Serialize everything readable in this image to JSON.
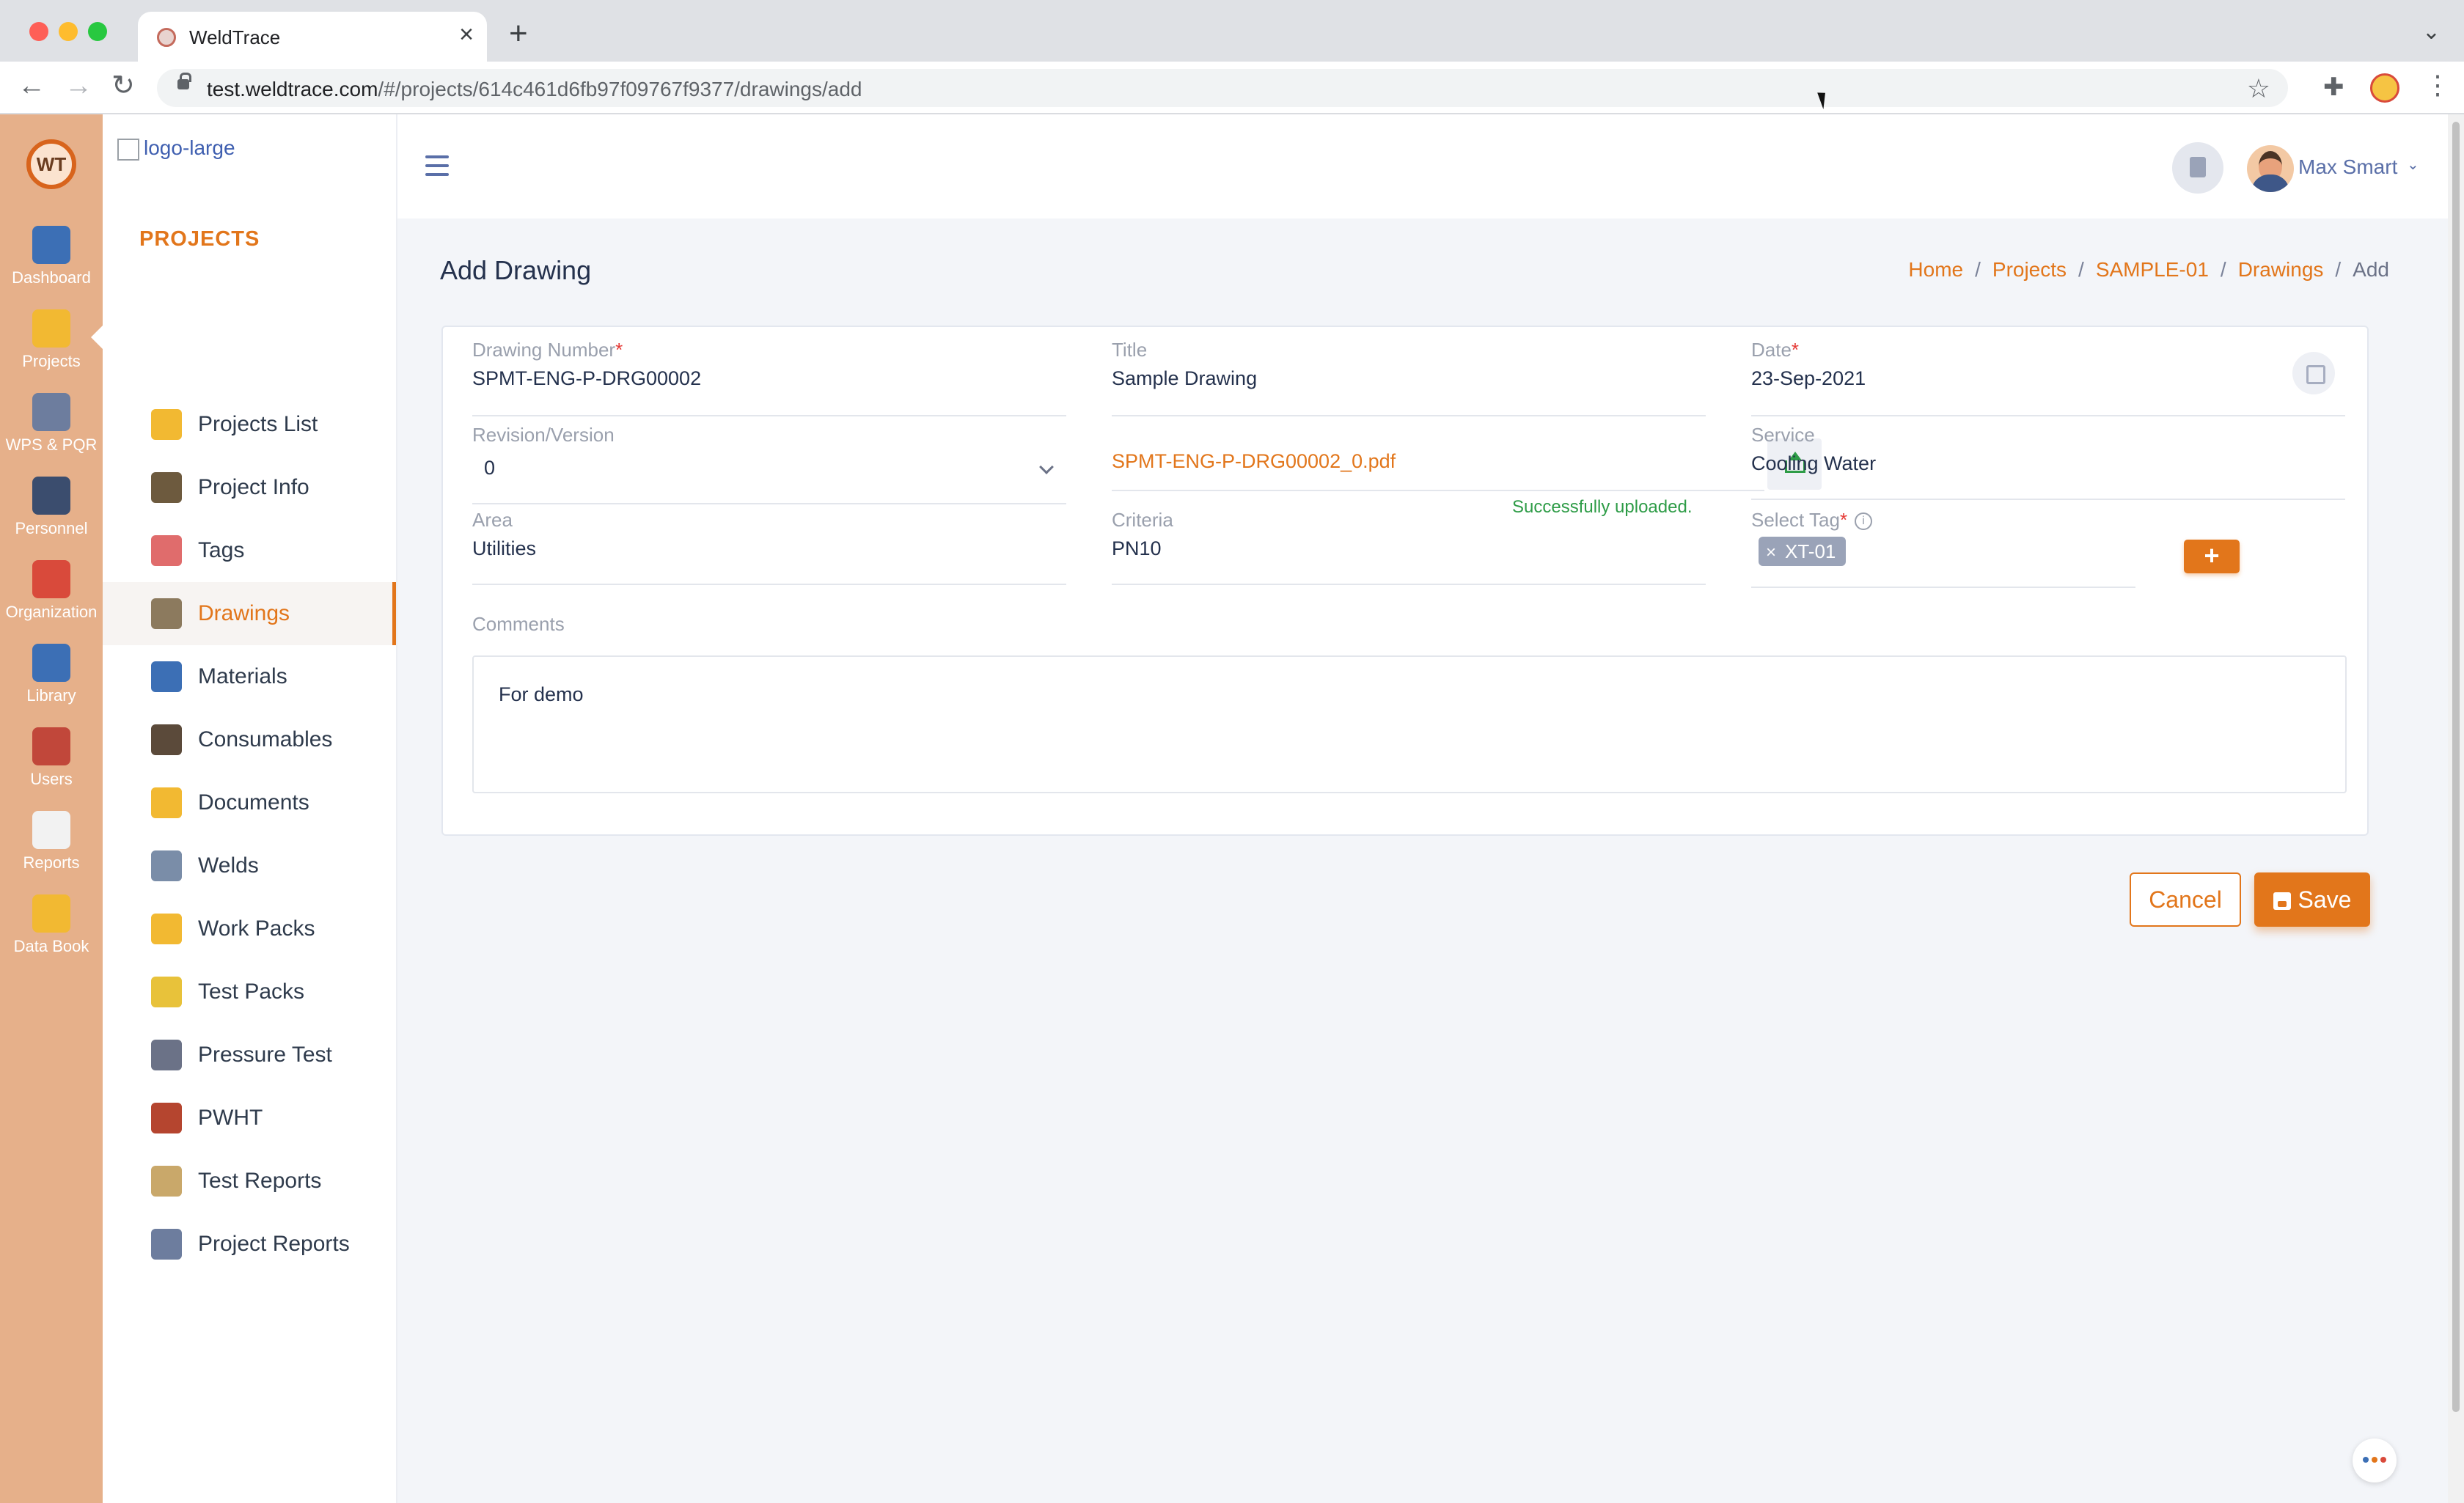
{
  "browser": {
    "tab_title": "WeldTrace",
    "url_host": "test.weldtrace.com",
    "url_path": "/#/projects/614c461d6fb97f09767f9377/drawings/add"
  },
  "rail": {
    "logo_text": "WT",
    "items": [
      {
        "label": "Dashboard",
        "icon": "dashboard-icon",
        "color": "#3c6fb5"
      },
      {
        "label": "Projects",
        "icon": "projects-folder-icon",
        "color": "#f2b932"
      },
      {
        "label": "WPS & PQR",
        "icon": "wps-pqr-icon",
        "color": "#6d7d9e"
      },
      {
        "label": "Personnel",
        "icon": "personnel-icon",
        "color": "#3b4d6e"
      },
      {
        "label": "Organization",
        "icon": "organization-icon",
        "color": "#d94a3b"
      },
      {
        "label": "Library",
        "icon": "library-icon",
        "color": "#3c6fb5"
      },
      {
        "label": "Users",
        "icon": "users-icon",
        "color": "#c1473a"
      },
      {
        "label": "Reports",
        "icon": "reports-icon",
        "color": "#f2f2f2"
      },
      {
        "label": "Data Book",
        "icon": "data-book-icon",
        "color": "#f2b932"
      }
    ]
  },
  "sidebar": {
    "logo_alt": "logo-large",
    "heading": "PROJECTS",
    "items": [
      {
        "label": "Projects List",
        "icon": "projects-list-icon",
        "color": "#f2b932"
      },
      {
        "label": "Project Info",
        "icon": "project-info-icon",
        "color": "#6d5a3e"
      },
      {
        "label": "Tags",
        "icon": "tags-icon",
        "color": "#e06c6c"
      },
      {
        "label": "Drawings",
        "icon": "drawings-icon",
        "color": "#8c7a5e"
      },
      {
        "label": "Materials",
        "icon": "materials-icon",
        "color": "#3c6fb5"
      },
      {
        "label": "Consumables",
        "icon": "consumables-icon",
        "color": "#5b4a3a"
      },
      {
        "label": "Documents",
        "icon": "documents-icon",
        "color": "#f2b932"
      },
      {
        "label": "Welds",
        "icon": "welds-icon",
        "color": "#7a8da8"
      },
      {
        "label": "Work Packs",
        "icon": "work-packs-icon",
        "color": "#f2b932"
      },
      {
        "label": "Test Packs",
        "icon": "test-packs-icon",
        "color": "#e8c23a"
      },
      {
        "label": "Pressure Test",
        "icon": "pressure-test-icon",
        "color": "#6b7287"
      },
      {
        "label": "PWHT",
        "icon": "pwht-icon",
        "color": "#b5452f"
      },
      {
        "label": "Test Reports",
        "icon": "test-reports-icon",
        "color": "#c9a86a"
      },
      {
        "label": "Project Reports",
        "icon": "project-reports-icon",
        "color": "#6d7d9e"
      }
    ]
  },
  "header": {
    "user_name": "Max Smart"
  },
  "page": {
    "title": "Add Drawing",
    "breadcrumb": [
      "Home",
      "Projects",
      "SAMPLE-01",
      "Drawings",
      "Add"
    ]
  },
  "form": {
    "drawing_number": {
      "label": "Drawing Number",
      "value": "SPMT-ENG-P-DRG00002"
    },
    "title": {
      "label": "Title",
      "value": "Sample Drawing"
    },
    "date": {
      "label": "Date",
      "value": "23-Sep-2021"
    },
    "revision": {
      "label": "Revision/Version",
      "value": "0"
    },
    "file": {
      "name": "SPMT-ENG-P-DRG00002_0.pdf",
      "status": "Successfully uploaded."
    },
    "service": {
      "label": "Service",
      "value": "Cooling Water"
    },
    "area": {
      "label": "Area",
      "value": "Utilities"
    },
    "criteria": {
      "label": "Criteria",
      "value": "PN10"
    },
    "tag": {
      "label": "Select Tag",
      "chip": "XT-01",
      "add_label": "+"
    },
    "comments": {
      "label": "Comments",
      "value": "For demo"
    }
  },
  "actions": {
    "cancel": "Cancel",
    "save": "Save"
  },
  "colors": {
    "accent": "#e2761b",
    "rail": "#e6b08a",
    "success": "#2e9c47"
  }
}
